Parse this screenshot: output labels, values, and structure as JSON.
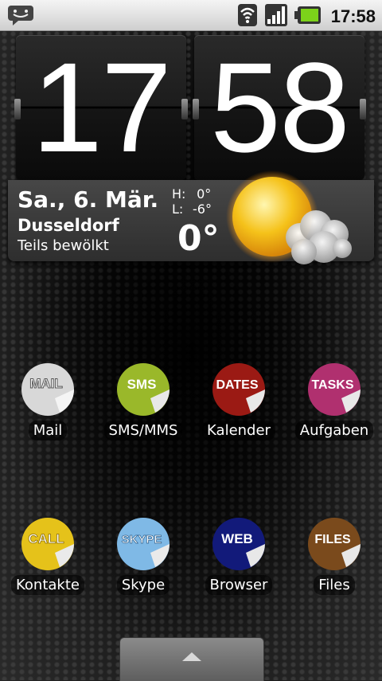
{
  "status_bar": {
    "time": "17:58",
    "icons": [
      "notification-chat-icon",
      "wifi-icon",
      "signal-icon",
      "battery-icon"
    ]
  },
  "clock": {
    "hours": "17",
    "minutes": "58"
  },
  "weather": {
    "date": "Sa., 6. Mär.",
    "city": "Dusseldorf",
    "condition": "Teils bewölkt",
    "high_label": "H:",
    "high": "0°",
    "low_label": "L:",
    "low": "-6°",
    "temperature": "0°",
    "icon": "partly-cloudy-icon"
  },
  "apps": [
    {
      "label": "Mail",
      "sticker_text": "MAIL",
      "color": "#d8d8d8",
      "text_color": "#ffffff"
    },
    {
      "label": "SMS/MMS",
      "sticker_text": "SMS",
      "color": "#9ab82a",
      "text_color": "#ffffff"
    },
    {
      "label": "Kalender",
      "sticker_text": "DATES",
      "color": "#9b1a14",
      "text_color": "#ffffff"
    },
    {
      "label": "Aufgaben",
      "sticker_text": "TASKS",
      "color": "#b0306f",
      "text_color": "#ffffff"
    },
    {
      "label": "Kontakte",
      "sticker_text": "CALL",
      "color": "#e5c21a",
      "text_color": "#ffffff"
    },
    {
      "label": "Skype",
      "sticker_text": "SKYPE",
      "color": "#7fb9e6",
      "text_color": "#ffffff"
    },
    {
      "label": "Browser",
      "sticker_text": "WEB",
      "color": "#121a7a",
      "text_color": "#ffffff"
    },
    {
      "label": "Files",
      "sticker_text": "FILES",
      "color": "#7a4a1c",
      "text_color": "#ffffff"
    }
  ],
  "drawer": {
    "icon": "chevron-up-icon"
  }
}
